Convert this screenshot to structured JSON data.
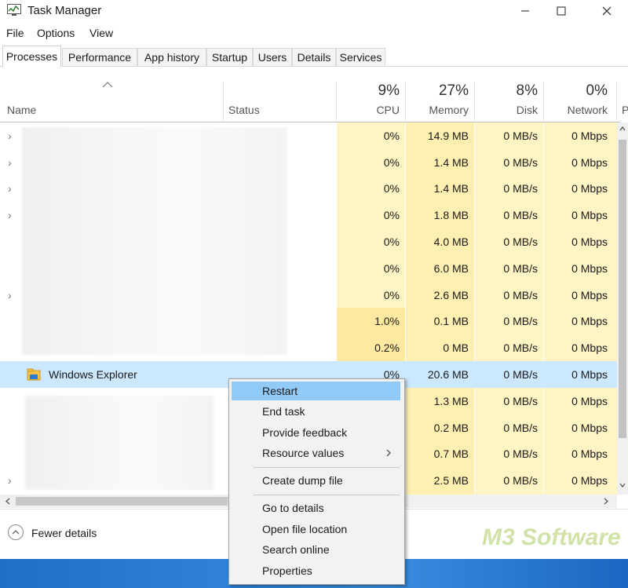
{
  "window": {
    "title": "Task Manager"
  },
  "menu": [
    "File",
    "Options",
    "View"
  ],
  "tabs": [
    "Processes",
    "Performance",
    "App history",
    "Startup",
    "Users",
    "Details",
    "Services"
  ],
  "header": {
    "name": "Name",
    "status": "Status",
    "cpu_pct": "9%",
    "cpu": "CPU",
    "mem_pct": "27%",
    "mem": "Memory",
    "disk_pct": "8%",
    "disk": "Disk",
    "net_pct": "0%",
    "net": "Network",
    "power_partial": "P"
  },
  "rows": [
    {
      "cpu": "0%",
      "mem": "14.9 MB",
      "disk": "0 MB/s",
      "net": "0 Mbps"
    },
    {
      "cpu": "0%",
      "mem": "1.4 MB",
      "disk": "0 MB/s",
      "net": "0 Mbps"
    },
    {
      "cpu": "0%",
      "mem": "1.4 MB",
      "disk": "0 MB/s",
      "net": "0 Mbps"
    },
    {
      "cpu": "0%",
      "mem": "1.8 MB",
      "disk": "0 MB/s",
      "net": "0 Mbps"
    },
    {
      "cpu": "0%",
      "mem": "4.0 MB",
      "disk": "0 MB/s",
      "net": "0 Mbps"
    },
    {
      "cpu": "0%",
      "mem": "6.0 MB",
      "disk": "0 MB/s",
      "net": "0 Mbps"
    },
    {
      "cpu": "0%",
      "mem": "2.6 MB",
      "disk": "0 MB/s",
      "net": "0 Mbps"
    },
    {
      "cpu": "1.0%",
      "mem": "0.1 MB",
      "disk": "0 MB/s",
      "net": "0 Mbps"
    },
    {
      "cpu": "0.2%",
      "mem": "0 MB",
      "disk": "0 MB/s",
      "net": "0 Mbps"
    },
    {
      "name": "Windows Explorer",
      "cpu": "0%",
      "mem": "20.6 MB",
      "disk": "0 MB/s",
      "net": "0 Mbps"
    },
    {
      "cpu": "",
      "mem": "1.3 MB",
      "disk": "0 MB/s",
      "net": "0 Mbps"
    },
    {
      "cpu": "",
      "mem": "0.2 MB",
      "disk": "0 MB/s",
      "net": "0 Mbps"
    },
    {
      "cpu": "",
      "mem": "0.7 MB",
      "disk": "0 MB/s",
      "net": "0 Mbps"
    },
    {
      "cpu": "",
      "mem": "2.5 MB",
      "disk": "0 MB/s",
      "net": "0 Mbps"
    }
  ],
  "context_menu": {
    "restart": "Restart",
    "end_task": "End task",
    "provide_feedback": "Provide feedback",
    "resource_values": "Resource values",
    "create_dump": "Create dump file",
    "go_to_details": "Go to details",
    "open_file_location": "Open file location",
    "search_online": "Search online",
    "properties": "Properties"
  },
  "footer": {
    "fewer_details": "Fewer details"
  },
  "watermark": "M3 Software",
  "colors": {
    "selection": "#cce8ff",
    "menu_highlight": "#91c9f7",
    "cpu_heat": "#fff4c4",
    "taskbar": "#2a7fd6"
  }
}
